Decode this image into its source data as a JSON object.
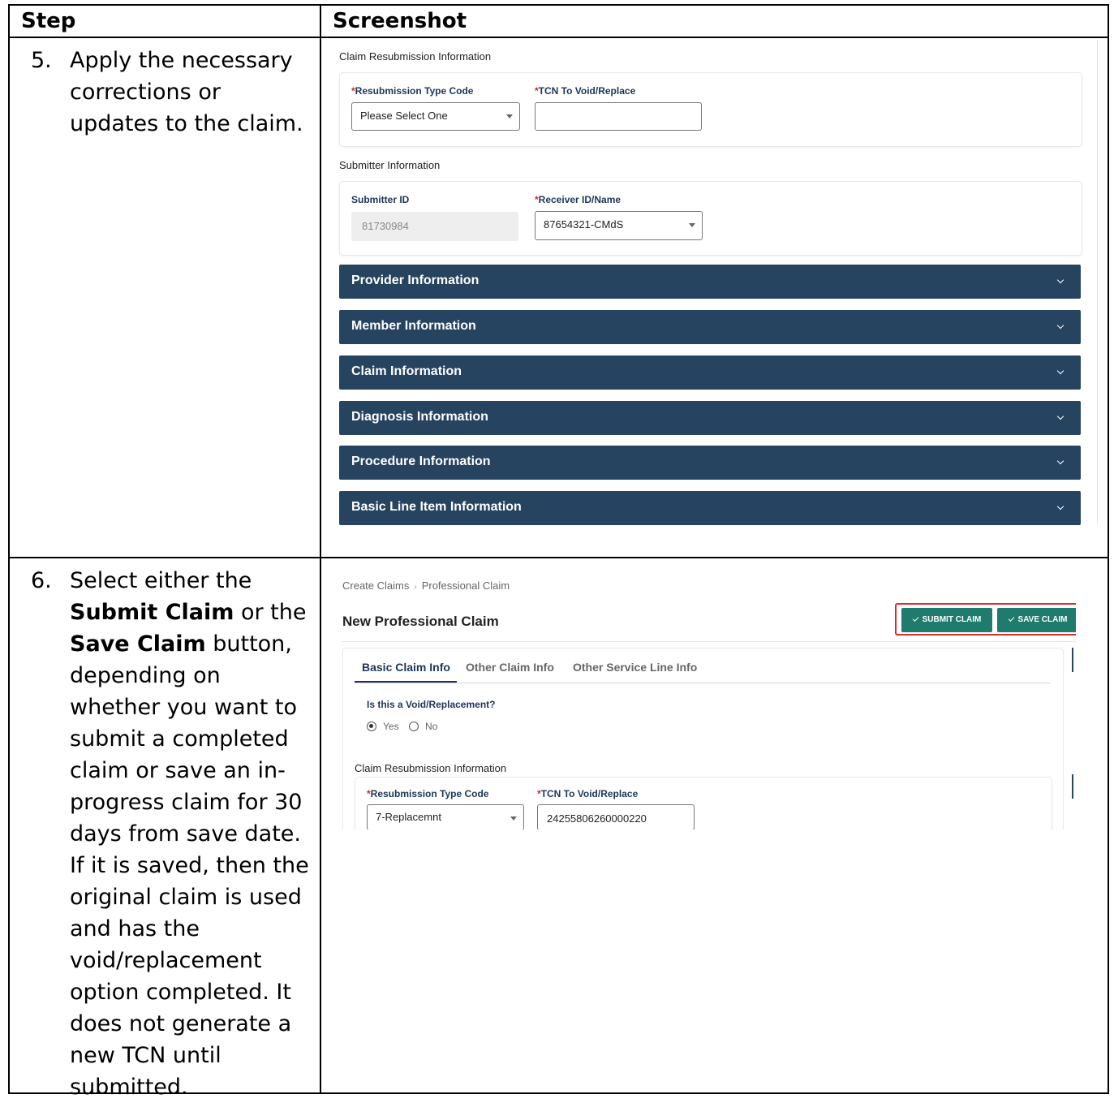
{
  "table": {
    "header_step": "Step",
    "header_screenshot": "Screenshot"
  },
  "step5": {
    "number": "5.",
    "text": "Apply the necessary corrections or updates to the claim."
  },
  "step6": {
    "number": "6.",
    "text_pre": "Select either the ",
    "bold1": "Submit Claim",
    "text_mid": " or the ",
    "bold2": "Save Claim",
    "text_post": " button, depending on whether you want to submit a completed claim or save an in-progress claim for 30 days from save date. If it is saved, then the original claim is used and has the void/replacement option completed. It does not generate a new TCN until submitted."
  },
  "screenshot1": {
    "resubmission_section": "Claim Resubmission Information",
    "resubmission_type_label": "Resubmission Type Code",
    "resubmission_type_value": "Please Select One",
    "tcn_label": "TCN To Void/Replace",
    "tcn_value": "",
    "submitter_section": "Submitter Information",
    "submitter_id_label": "Submitter ID",
    "submitter_id_value": "81730984",
    "receiver_label": "Receiver ID/Name",
    "receiver_value": "87654321-CMdS",
    "required_mark": "*",
    "accordions": [
      "Provider Information",
      "Member Information",
      "Claim Information",
      "Diagnosis Information",
      "Procedure Information",
      "Basic Line Item Information"
    ]
  },
  "screenshot2": {
    "breadcrumb": [
      "Create Claims",
      "Professional Claim"
    ],
    "breadcrumb_sep": "›",
    "title": "New Professional Claim",
    "submit_button": "SUBMIT CLAIM",
    "save_button": "SAVE CLAIM",
    "tabs": [
      "Basic Claim Info",
      "Other Claim Info",
      "Other Service Line Info"
    ],
    "void_question": "Is this a Void/Replacement?",
    "radio_yes": "Yes",
    "radio_no": "No",
    "radio_selected": "Yes",
    "resubmission_section": "Claim Resubmission Information",
    "resubmission_type_label": "Resubmission Type Code",
    "resubmission_type_value": "7-Replacemnt",
    "tcn_label": "TCN To Void/Replace",
    "tcn_value": "24255806260000220",
    "required_mark": "*"
  },
  "colors": {
    "accordion": "#264360",
    "label": "#1d3557",
    "required": "#c62828",
    "button": "#1e7b6e",
    "highlight": "#d32f2f"
  }
}
